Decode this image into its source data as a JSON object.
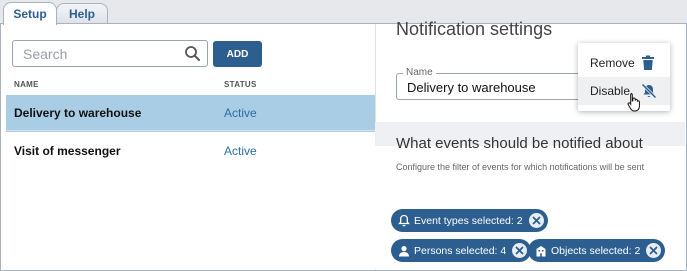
{
  "tabs": [
    {
      "label": "Setup",
      "active": true
    },
    {
      "label": "Help",
      "active": false
    }
  ],
  "search": {
    "placeholder": "Search",
    "value": "",
    "icon": "search-icon"
  },
  "add_button": {
    "label": "ADD"
  },
  "table": {
    "columns": [
      "NAME",
      "STATUS"
    ],
    "rows": [
      {
        "name": "Delivery to warehouse",
        "status": "Active",
        "selected": true
      },
      {
        "name": "Visit of messenger",
        "status": "Active",
        "selected": false
      }
    ]
  },
  "detail": {
    "title": "Notification settings",
    "name_field": {
      "label": "Name",
      "value": "Delivery to warehouse"
    },
    "events_title": "What events should be notified about",
    "events_subtitle": "Configure the filter of events for which notifications will be sent",
    "chips": [
      {
        "label": "Event types selected: 2",
        "icon": "bell-icon"
      },
      {
        "label": "Persons selected: 4",
        "icon": "person-icon"
      },
      {
        "label": "Objects selected: 2",
        "icon": "building-icon"
      }
    ]
  },
  "menu": {
    "items": [
      {
        "label": "Remove",
        "icon": "trash-icon"
      },
      {
        "label": "Disable",
        "icon": "bell-off-icon",
        "hovered": true
      }
    ]
  },
  "colors": {
    "accent": "#2c5f8f",
    "selected_row": "#a9cde4",
    "status_text": "#2c6da6"
  }
}
